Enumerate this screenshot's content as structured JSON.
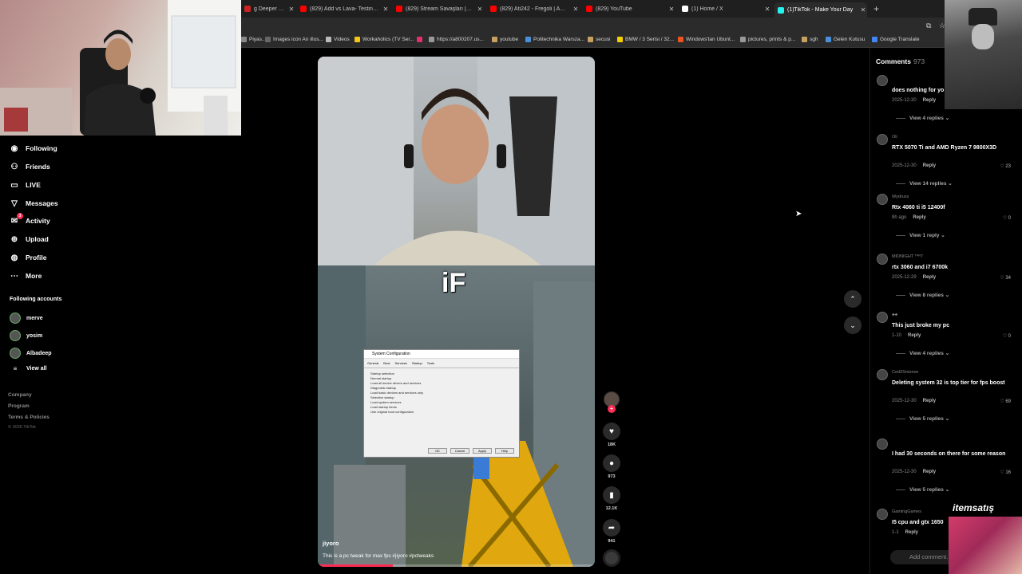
{
  "browser": {
    "tabs": [
      {
        "title": "g Deeper into the An",
        "fav_color": "#cc2222"
      },
      {
        "title": "(829) Add vs Lava- Testing Liqu",
        "fav_color": "#ff0000"
      },
      {
        "title": "(829) Stream Savaşları | Ebo x L",
        "fav_color": "#ff0000"
      },
      {
        "title": "(829) Ati242 - Fregoli | AK Exclu",
        "fav_color": "#ff0000"
      },
      {
        "title": "(829) YouTube",
        "fav_color": "#ff0000"
      },
      {
        "title": "(1) Home / X",
        "fav_color": "#ffffff"
      },
      {
        "title": "(1)TikTok - Make Your Day",
        "fav_color": "#25f4ee"
      }
    ],
    "new_tab_label": "+",
    "bookmarks": [
      {
        "label": "Piyas...",
        "color": "#888888"
      },
      {
        "label": "Images icon An illus...",
        "color": "#666666"
      },
      {
        "label": "Videos",
        "color": "#bbbbbb"
      },
      {
        "label": "Workaholics (TV Ser...",
        "color": "#f5c518"
      },
      {
        "label": "",
        "color": "#e1306c"
      },
      {
        "label": "https://a800207.us...",
        "color": "#999999"
      },
      {
        "label": "youtube",
        "color": "#c8a060"
      },
      {
        "label": "Politechnika Warsza...",
        "color": "#4a90d9"
      },
      {
        "label": "secusi",
        "color": "#c8a060"
      },
      {
        "label": "BMW / 3 Serisi / 32...",
        "color": "#f5d000"
      },
      {
        "label": "Windows'tan Ubunt...",
        "color": "#e95420"
      },
      {
        "label": "pictures, prints & p...",
        "color": "#999999"
      },
      {
        "label": "sgh",
        "color": "#c8a060"
      },
      {
        "label": "Gelen Kutusu",
        "color": "#4a90d9"
      },
      {
        "label": "Google Translate",
        "color": "#4285f4"
      }
    ]
  },
  "sidebar": {
    "nav": [
      {
        "label": "Following",
        "icon": "following-icon"
      },
      {
        "label": "Friends",
        "icon": "friends-icon"
      },
      {
        "label": "LIVE",
        "icon": "live-icon"
      },
      {
        "label": "Messages",
        "icon": "messages-icon"
      },
      {
        "label": "Activity",
        "icon": "activity-icon",
        "badge": "3"
      },
      {
        "label": "Upload",
        "icon": "upload-icon"
      },
      {
        "label": "Profile",
        "icon": "profile-icon"
      },
      {
        "label": "More",
        "icon": "more-icon"
      }
    ],
    "following_title": "Following accounts",
    "accounts": [
      "merve",
      "yosim",
      "Albadeep"
    ],
    "view_all": "View all",
    "footer_links": [
      "Company",
      "Program",
      "Terms & Policies"
    ],
    "copyright": "© 2026 TikTok"
  },
  "video": {
    "overlay_caption": "iF",
    "dialog": {
      "title": "System Configuration",
      "tabs": [
        "General",
        "Boot",
        "Services",
        "Startup",
        "Tools"
      ],
      "lines": [
        "Startup selection",
        "Normal startup",
        "Load all device drivers and services",
        "Diagnostic startup",
        "Load basic devices and services only",
        "Selective startup",
        "Load system services",
        "Load startup items",
        "Use original boot configuration"
      ],
      "buttons": [
        "OK",
        "Cancel",
        "Apply",
        "Help"
      ]
    },
    "username": "jiyoro",
    "description": "This is a pc tweak for max fps #jiyoro #pctweaks",
    "progress": 0.27
  },
  "actions": {
    "likes": "18K",
    "comments": "973",
    "saves": "12.1K",
    "shares": "941"
  },
  "comments": {
    "title": "Comments",
    "count": "973",
    "items": [
      {
        "user": "",
        "text": "does nothing for yo",
        "date": "2025-12-30",
        "likes": "",
        "views": "View 4 replies"
      },
      {
        "user": "Oli",
        "text": "RTX 5070 Ti and AMD Ryzen 7 9800X3D",
        "date": "2025-12-30",
        "likes": "23",
        "views": "View 14 replies"
      },
      {
        "user": "Wydruss",
        "text": "Rtx 4060 ti i5 12400f",
        "date": "8h ago",
        "likes": "0",
        "views": "View 1 reply"
      },
      {
        "user": "MIDNIGHT ᵀᴬᴺ7",
        "text": "rtx 3060 and i7 6700k",
        "date": "2025-12-29",
        "likes": "34",
        "views": "View 8 replies"
      },
      {
        "user": "♣♣",
        "text": "This just broke my pc",
        "date": "1-10",
        "likes": "0",
        "views": "View 4 replies"
      },
      {
        "user": "Ced2Smoove",
        "text": "Deleting system 32 is top tier for fps boost",
        "date": "2025-12-30",
        "likes": "69",
        "views": "View 5 replies"
      },
      {
        "user": "",
        "text": "I had 30 seconds on there for some reason",
        "date": "2025-12-30",
        "likes": "16",
        "views": "View 5 replies"
      },
      {
        "user": "GamingGames",
        "text": "I5 cpu and gtx 1650",
        "date": "1-1",
        "likes": "",
        "views": ""
      }
    ],
    "reply_label": "Reply",
    "add_placeholder": "Add comment..."
  },
  "overlay": {
    "brand": "itemsatış"
  }
}
